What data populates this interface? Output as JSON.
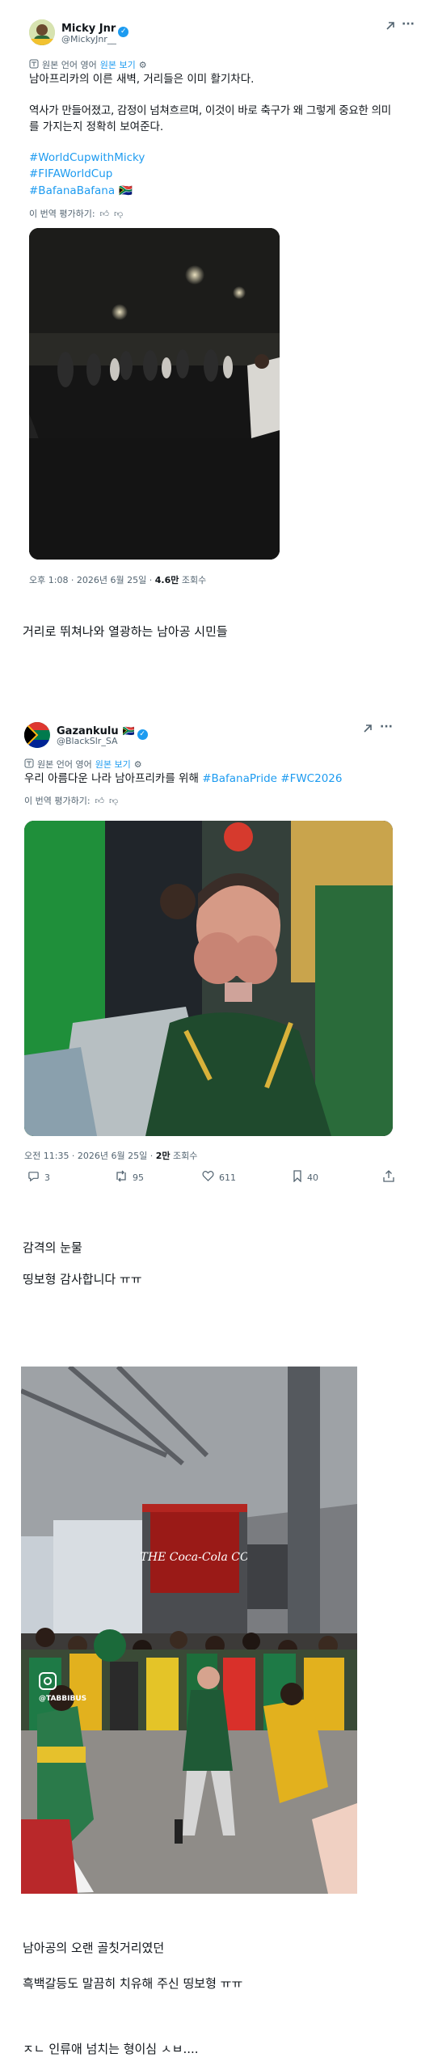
{
  "tweet1": {
    "name": "Micky Jnr",
    "handle": "@MickyJnr__",
    "original_lang_note": "원본 언어 영어",
    "view_original": "원본 보기",
    "body_line1": "남아프리카의 이른 새벽, 거리들은 이미 활기차다.",
    "body_line2": "역사가 만들어졌고, 감정이 넘쳐흐르며, 이것이 바로 축구가 왜 그렇게 중요한 의미",
    "body_line3": "를 가지는지 정확히 보여준다.",
    "hashtag1": "#WorldCupwithMicky",
    "hashtag2": "#FIFAWorldCup",
    "hashtag3": "#BafanaBafana",
    "hashtag3_flag": "🇿🇦",
    "rate_translation": "이 번역 평가하기:",
    "meta_time": "오후 1:08 · 2026년 6월 25일 ·",
    "meta_views_count": "4.6만",
    "meta_views_label": "조회수"
  },
  "caption1": "거리로 뛰쳐나와 열광하는 남아공 시민들",
  "tweet2": {
    "name": "Gazankulu",
    "name_flag": "🇿🇦",
    "handle": "@BlackSlr_SA",
    "original_lang_note": "원본 언어 영어",
    "view_original": "원본 보기",
    "body_text": "우리 아름다운 나라 남아프리카를 위해",
    "body_hashtags": "#BafanaPride #FWC2026",
    "rate_translation": "이 번역 평가하기:",
    "meta_time": "오전 11:35 · 2026년 6월 25일 ·",
    "meta_views_count": "2만",
    "meta_views_label": "조회수",
    "replies": "3",
    "retweets": "95",
    "likes": "611",
    "bookmarks": "40"
  },
  "caption2a": "감격의 눈물",
  "caption2b": "띵보형 감사합니다 ㅠㅠ",
  "video3": {
    "banner_text": "THE Coca-Cola CO",
    "instagram_tag": "@TABBIBUS"
  },
  "caption3a": "남아공의 오랜 골칫거리였던",
  "caption3b": "흑백갈등도 말끔히 치유해 주신 띵보형 ㅠㅠ",
  "caption3c": "ㅈㄴ 인류애 넘치는 형이심 ㅅㅂ....",
  "icons": {
    "grok": "grok-icon",
    "more": "more-icon",
    "translate": "translate-icon",
    "settings": "settings-icon",
    "thumbs_up": "thumbs-up-icon",
    "thumbs_down": "thumbs-down-icon",
    "reply": "reply-icon",
    "retweet": "retweet-icon",
    "like": "like-icon",
    "bookmark": "bookmark-icon",
    "share": "share-icon",
    "instagram": "instagram-icon"
  },
  "colors": {
    "link": "#1d9bf0",
    "text": "#0f1419",
    "secondary": "#536471",
    "verified": "#1d9bf0"
  }
}
